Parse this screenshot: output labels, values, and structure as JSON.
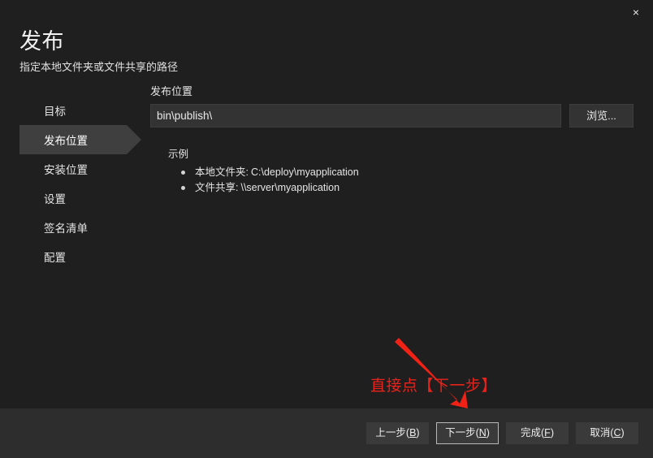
{
  "window": {
    "close_icon": "×"
  },
  "header": {
    "title": "发布",
    "subtitle": "指定本地文件夹或文件共享的路径"
  },
  "sidebar": {
    "items": [
      {
        "label": "目标",
        "selected": false
      },
      {
        "label": "发布位置",
        "selected": true
      },
      {
        "label": "安装位置",
        "selected": false
      },
      {
        "label": "设置",
        "selected": false
      },
      {
        "label": "签名清单",
        "selected": false
      },
      {
        "label": "配置",
        "selected": false
      }
    ]
  },
  "main": {
    "field_label": "发布位置",
    "path_value": "bin\\publish\\",
    "browse_label": "浏览...",
    "examples_title": "示例",
    "examples": [
      {
        "label": "本地文件夹:",
        "value": "C:\\deploy\\myapplication"
      },
      {
        "label": "文件共享:",
        "value": "\\\\server\\myapplication"
      }
    ]
  },
  "annotation": {
    "text": "直接点【下一步】",
    "color": "#e8231c"
  },
  "footer": {
    "buttons": [
      {
        "text_before": "上一步(",
        "accel": "B",
        "text_after": ")",
        "focused": false
      },
      {
        "text_before": "下一步(",
        "accel": "N",
        "text_after": ")",
        "focused": true
      },
      {
        "text_before": "完成(",
        "accel": "F",
        "text_after": ")",
        "focused": false
      },
      {
        "text_before": "取消(",
        "accel": "C",
        "text_after": ")",
        "focused": false
      }
    ]
  }
}
